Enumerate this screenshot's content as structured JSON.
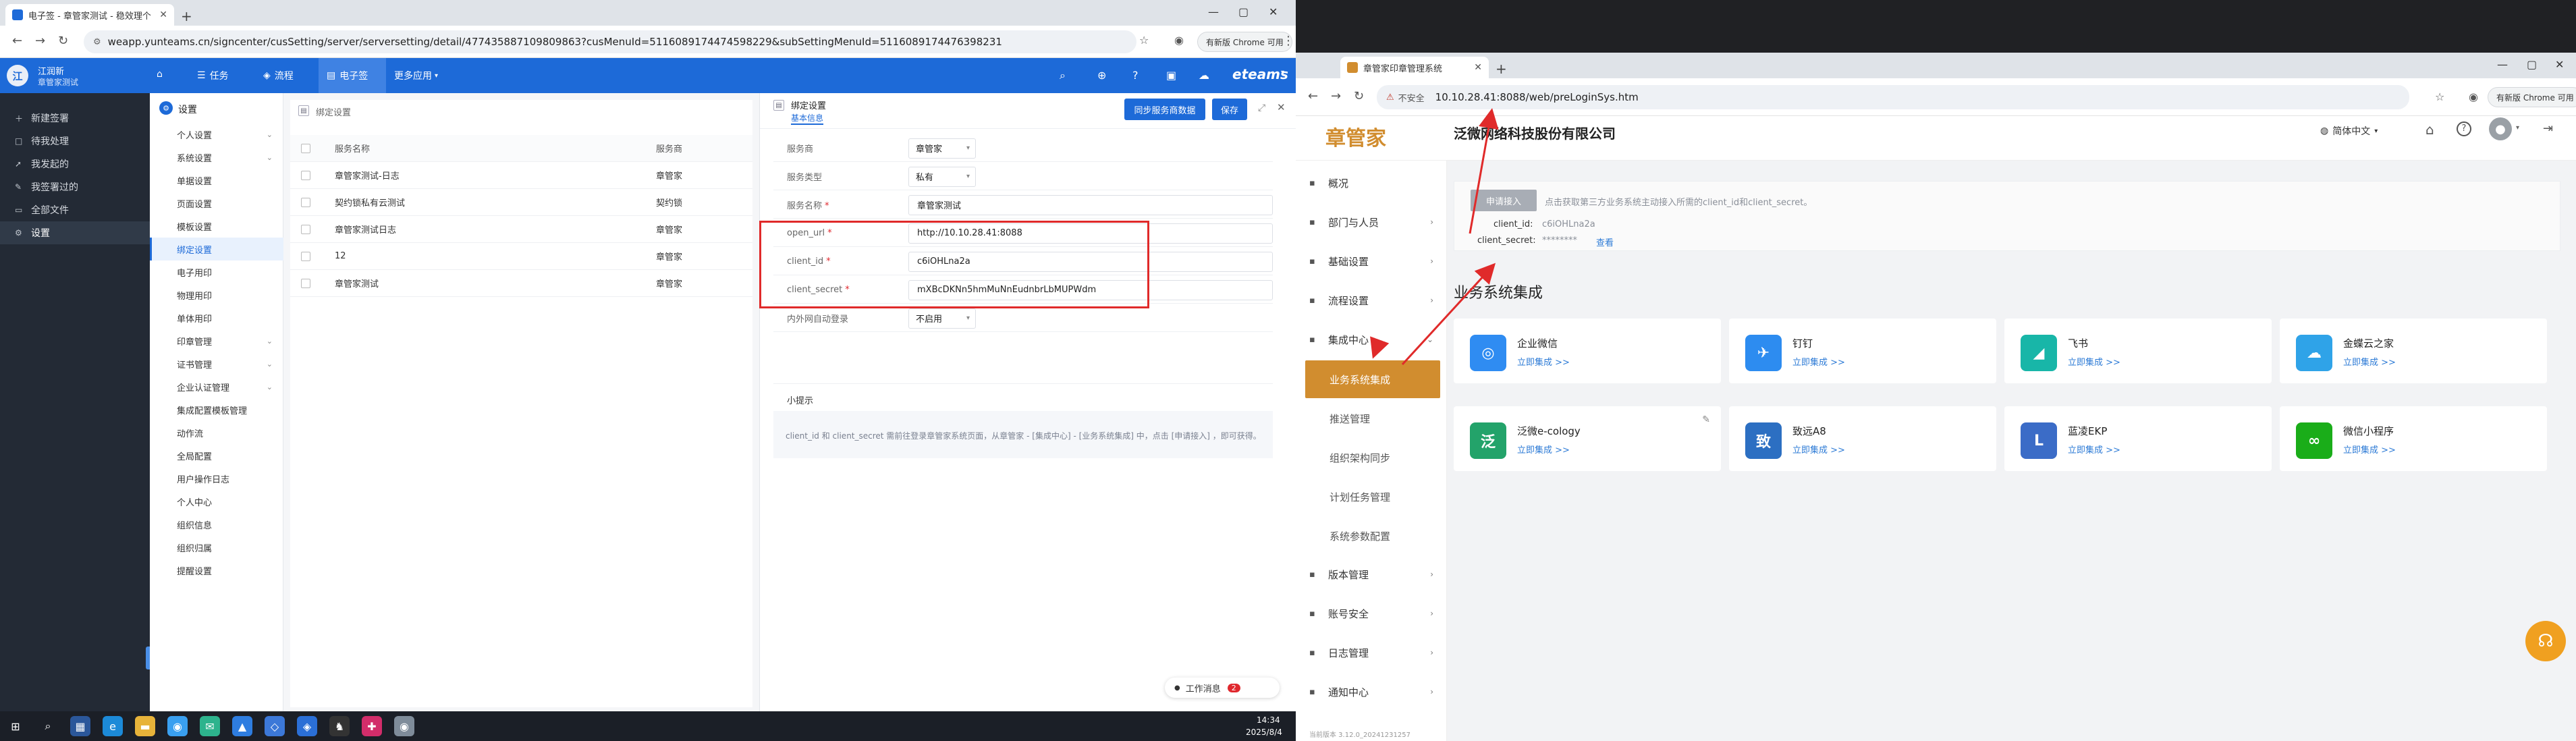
{
  "left_browser": {
    "tab_title": "电子签 - 章管家测试 - 稳效理个",
    "url": "weapp.yunteams.cn/signcenter/cusSetting/server/serversetting/detail/477435887109809863?cusMenuId=511608917447459822​9&subSettingMenuId=5116089174476398231",
    "chrome_pill": "有新版 Chrome 可用",
    "colors": {
      "header": "#1d6ad8",
      "sidebar": "#232a35",
      "highlight": "#e02a2a"
    }
  },
  "app": {
    "user": {
      "name": "江润新",
      "org": "章管家测试"
    },
    "top_nav": [
      {
        "label": "",
        "icon": "home-icon"
      },
      {
        "label": "任务",
        "icon": "list-icon"
      },
      {
        "label": "流程",
        "icon": "flow-icon"
      },
      {
        "label": "电子签",
        "icon": "sign-icon"
      },
      {
        "label": "更多应用",
        "icon": "chevron-down-icon"
      }
    ],
    "brand": "eteams",
    "left_nav": [
      {
        "label": "新建签署",
        "icon": "plus-icon"
      },
      {
        "label": "待我处理",
        "icon": "todo-icon"
      },
      {
        "label": "我发起的",
        "icon": "send-icon"
      },
      {
        "label": "我签署过的",
        "icon": "signed-icon"
      },
      {
        "label": "全部文件",
        "icon": "file-icon"
      },
      {
        "label": "设置",
        "icon": "gear-icon"
      }
    ],
    "sub_header": "设置",
    "sub_nav": [
      {
        "label": "个人设置",
        "caret": true
      },
      {
        "label": "系统设置",
        "caret": true
      },
      {
        "label": "单据设置"
      },
      {
        "label": "页面设置"
      },
      {
        "label": "模板设置"
      },
      {
        "label": "绑定设置"
      },
      {
        "label": "电子用印"
      },
      {
        "label": "物理用印"
      },
      {
        "label": "单体用印"
      },
      {
        "label": "印章管理",
        "caret": true
      },
      {
        "label": "证书管理",
        "caret": true
      },
      {
        "label": "企业认证管理",
        "caret": true
      },
      {
        "label": "集成配置模板管理"
      },
      {
        "label": "动作流"
      },
      {
        "label": "全局配置"
      },
      {
        "label": "用户操作日志"
      },
      {
        "label": "个人中心"
      },
      {
        "label": "组织信息"
      },
      {
        "label": "组织归属"
      },
      {
        "label": "提醒设置"
      }
    ],
    "list": {
      "breadcrumb": "绑定设置",
      "columns": [
        "服务名称",
        "服务商"
      ],
      "rows": [
        {
          "name": "章管家测试-日志",
          "vendor": "章管家"
        },
        {
          "name": "契约锁私有云测试",
          "vendor": "契约锁"
        },
        {
          "name": "章管家测试日志",
          "vendor": "章管家"
        },
        {
          "name": "12",
          "vendor": "章管家"
        },
        {
          "name": "章管家测试",
          "vendor": "章管家"
        }
      ]
    },
    "detail": {
      "title": "绑定设置",
      "subtitle": "基本信息",
      "sync_button": "同步服务商数据",
      "save_button": "保存",
      "fields": [
        {
          "label": "服务商",
          "value": "章管家",
          "type": "select"
        },
        {
          "label": "服务类型",
          "value": "私有",
          "type": "select"
        },
        {
          "label": "服务名称",
          "value": "章管家测试",
          "required": true
        },
        {
          "label": "open_url",
          "value": "http://10.10.28.41:8088",
          "required": true
        },
        {
          "label": "client_id",
          "value": "c6iOHLna2a",
          "required": true
        },
        {
          "label": "client_secret",
          "value": "mXBcDKNn5hmMuNnEudnbrLbMUPWdm",
          "required": true
        },
        {
          "label": "内外网自动登录",
          "value": "不启用",
          "type": "select"
        }
      ],
      "tip_title": "小提示",
      "tip_text": "client_id 和 client_secret 需前往登录章管家系统页面，从章管家 - [集成中心] - [业务系统集成] 中，点击 [申请接入] ，即可获得。",
      "work_notice": "工作消息",
      "work_notice_count": "2"
    }
  },
  "taskbar": {
    "time": "14:34",
    "date": "2025/8/4"
  },
  "right_browser": {
    "tab_title": "章管家印章管理系统",
    "insecure": "不安全",
    "url": "10.10.28.41:8088/web/preLoginSys.htm",
    "chrome_pill": "有新版 Chrome 可用"
  },
  "rapp": {
    "logo": "章管家",
    "company": "泛微网络科技股份有限公司",
    "lang": "简体中文",
    "nav": [
      {
        "label": "概况",
        "icon": "home-icon"
      },
      {
        "label": "部门与人员",
        "icon": "user-icon",
        "caret": true
      },
      {
        "label": "基础设置",
        "icon": "settings-icon",
        "caret": true
      },
      {
        "label": "流程设置",
        "icon": "flow-icon",
        "caret": true
      },
      {
        "label": "集成中心",
        "icon": "integration-icon",
        "caret": true
      }
    ],
    "sub": [
      {
        "label": "业务系统集成",
        "active": true
      },
      {
        "label": "推送管理"
      },
      {
        "label": "组织架构同步"
      },
      {
        "label": "计划任务管理"
      },
      {
        "label": "系统参数配置"
      }
    ],
    "nav2": [
      {
        "label": "版本管理",
        "icon": "version-icon",
        "caret": true
      },
      {
        "label": "账号安全",
        "icon": "security-icon",
        "caret": true
      },
      {
        "label": "日志管理",
        "icon": "log-icon",
        "caret": true
      },
      {
        "label": "通知中心",
        "icon": "bell-icon",
        "caret": true
      }
    ],
    "apply_button": "申请接入",
    "apply_hint": "点击获取第三方业务系统主动接入所需的client_id和client_secret。",
    "client_id_label": "client_id:",
    "client_id_value": "c6iOHLna2a",
    "client_secret_label": "client_secret:",
    "client_secret_value": "********",
    "view_link": "查看",
    "section_title": "业务系统集成",
    "cards": [
      {
        "name": "企业微信",
        "link": "立即集成 >>",
        "color": "#2f8cf2",
        "icon": "wecom-icon",
        "glyph": "◎"
      },
      {
        "name": "钉钉",
        "link": "立即集成 >>",
        "color": "#2d8cf0",
        "icon": "dingtalk-icon",
        "glyph": "✈"
      },
      {
        "name": "飞书",
        "link": "立即集成 >>",
        "color": "#18b6a8",
        "icon": "feishu-icon",
        "glyph": "◢"
      },
      {
        "name": "金蝶云之家",
        "link": "立即集成 >>",
        "color": "#2fa3e8",
        "icon": "kingdee-icon",
        "glyph": "☁"
      },
      {
        "name": "泛微e-cology",
        "link": "立即集成 >>",
        "color": "#23a36a",
        "icon": "ecology-icon",
        "glyph": "泛"
      },
      {
        "name": "致远A8",
        "link": "立即集成 >>",
        "color": "#2c6fc2",
        "icon": "seeyon-icon",
        "glyph": "致"
      },
      {
        "name": "蓝凌EKP",
        "link": "立即集成 >>",
        "color": "#3b6cc7",
        "icon": "landray-icon",
        "glyph": "L"
      },
      {
        "name": "微信小程序",
        "link": "立即集成 >>",
        "color": "#1aad19",
        "icon": "wechat-mini-icon",
        "glyph": "∞"
      }
    ],
    "footer": "当前版本 3.12.0_20241231257"
  }
}
